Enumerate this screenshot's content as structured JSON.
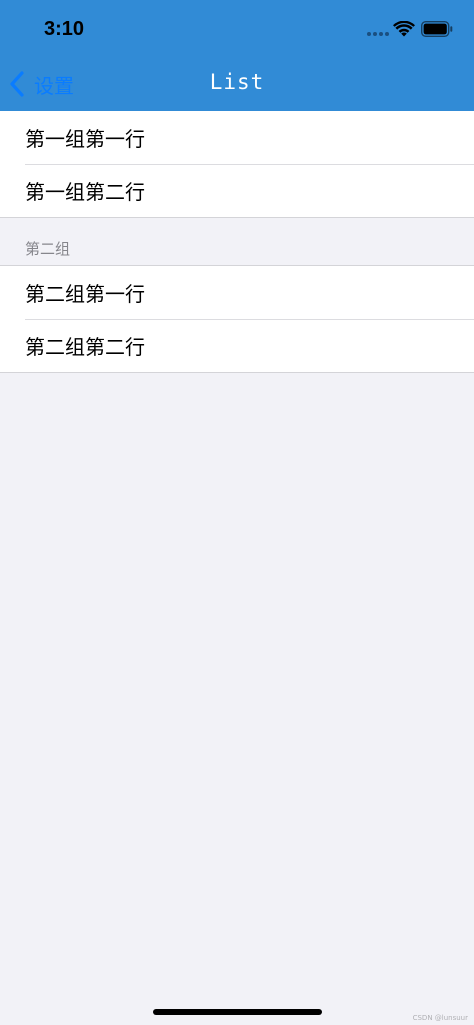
{
  "status_bar": {
    "time": "3:10",
    "icons": [
      "signal-dots-icon",
      "wifi-icon",
      "battery-icon"
    ]
  },
  "nav_bar": {
    "back_label": "设置",
    "title": "List",
    "background_color": "#318bd6",
    "back_color": "#0a7cff"
  },
  "table": {
    "sections": [
      {
        "header": "",
        "rows": [
          {
            "label": "第一组第一行"
          },
          {
            "label": "第一组第二行"
          }
        ]
      },
      {
        "header": "第二组",
        "rows": [
          {
            "label": "第二组第一行"
          },
          {
            "label": "第二组第二行"
          }
        ]
      }
    ]
  },
  "watermark": "CSDN @lunsuur"
}
